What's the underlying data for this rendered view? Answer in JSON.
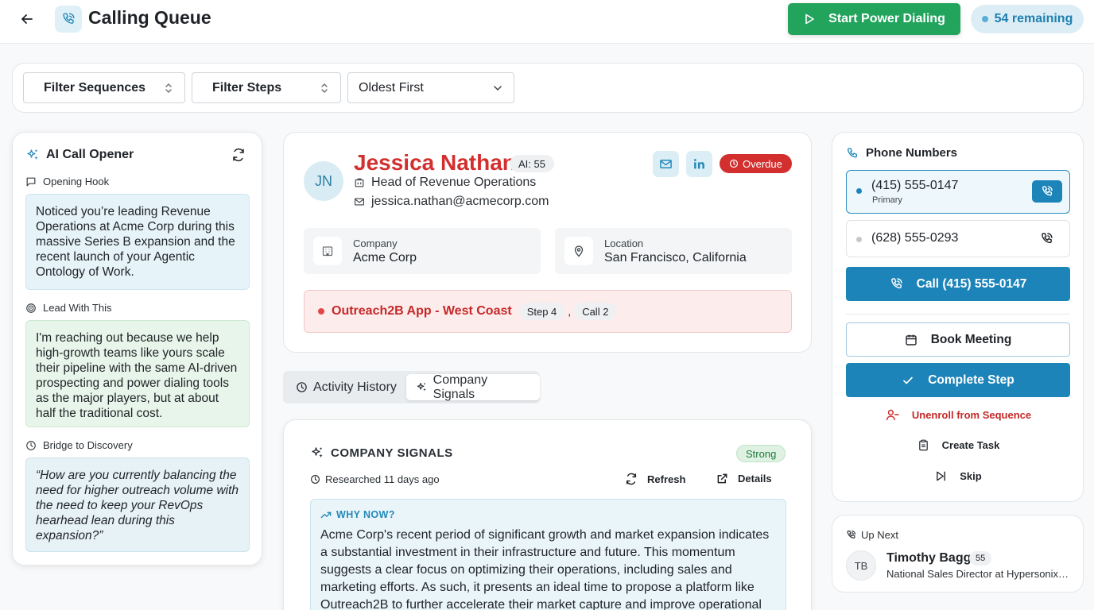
{
  "header": {
    "title": "Calling Queue",
    "power_dialing_label": "Start Power Dialing",
    "remaining_label": "54 remaining"
  },
  "filters": {
    "sequences": "Filter Sequences",
    "steps": "Filter Steps",
    "sort": "Oldest First"
  },
  "ai_opener": {
    "title": "AI Call Opener",
    "sections": [
      {
        "label": "Opening Hook",
        "text": "Noticed you’re leading Revenue Operations at Acme Corp during this massive Series B expansion and the recent launch of your Agentic Ontology of Work."
      },
      {
        "label": "Lead With This",
        "text": "I'm reaching out because we help high-growth teams like yours scale their pipeline with the same AI-driven prospecting and power dialing tools as the major players, but at about half the traditional cost."
      },
      {
        "label": "Bridge to Discovery",
        "text": "“How are you currently balancing the need for higher outreach volume with the need to keep your RevOps hearhead lean during this expansion?”"
      }
    ]
  },
  "contact": {
    "initials": "JN",
    "name": "Jessica Nathan",
    "ai_score": "AI: 55",
    "title": "Head of Revenue Operations",
    "email": "jessica.nathan@acmecorp.com",
    "status": "Overdue",
    "company_label": "Company",
    "company": "Acme Corp",
    "location_label": "Location",
    "location": "San Francisco, California",
    "sequence": "Outreach2B App - West Coast",
    "step": "Step 4",
    "separator": ",",
    "call": "Call 2"
  },
  "tabs": [
    {
      "label": "Activity History"
    },
    {
      "label": "Company Signals"
    }
  ],
  "signals": {
    "title": "COMPANY SIGNALS",
    "strength": "Strong",
    "researched": "Researched 11 days ago",
    "refresh": "Refresh",
    "details": "Details",
    "why_title": "WHY NOW?",
    "why_text": "Acme Corp's recent period of significant growth and market expansion indicates a substantial investment in their infrastructure and future. This momentum suggests a clear focus on optimizing their operations, including sales and marketing efforts. As such, it presents an ideal time to propose a platform like Outreach2B to further accelerate their market capture and improve operational efficiency."
  },
  "phones": {
    "title": "Phone Numbers",
    "numbers": [
      {
        "number": "(415) 555-0147",
        "label": "Primary"
      },
      {
        "number": "(628) 555-0293"
      }
    ],
    "call_label": "Call (415) 555-0147",
    "book_label": "Book Meeting",
    "complete_label": "Complete Step",
    "unenroll_label": "Unenroll from Sequence",
    "task_label": "Create Task",
    "skip_label": "Skip"
  },
  "up_next": {
    "title": "Up Next",
    "initials": "TB",
    "name": "Timothy Bagg",
    "score": "55",
    "role": "National Sales Director at Hypersonix I..."
  },
  "colors": {
    "accent": "#1d84b9",
    "success": "#22a45d",
    "danger": "#d32f2f"
  }
}
